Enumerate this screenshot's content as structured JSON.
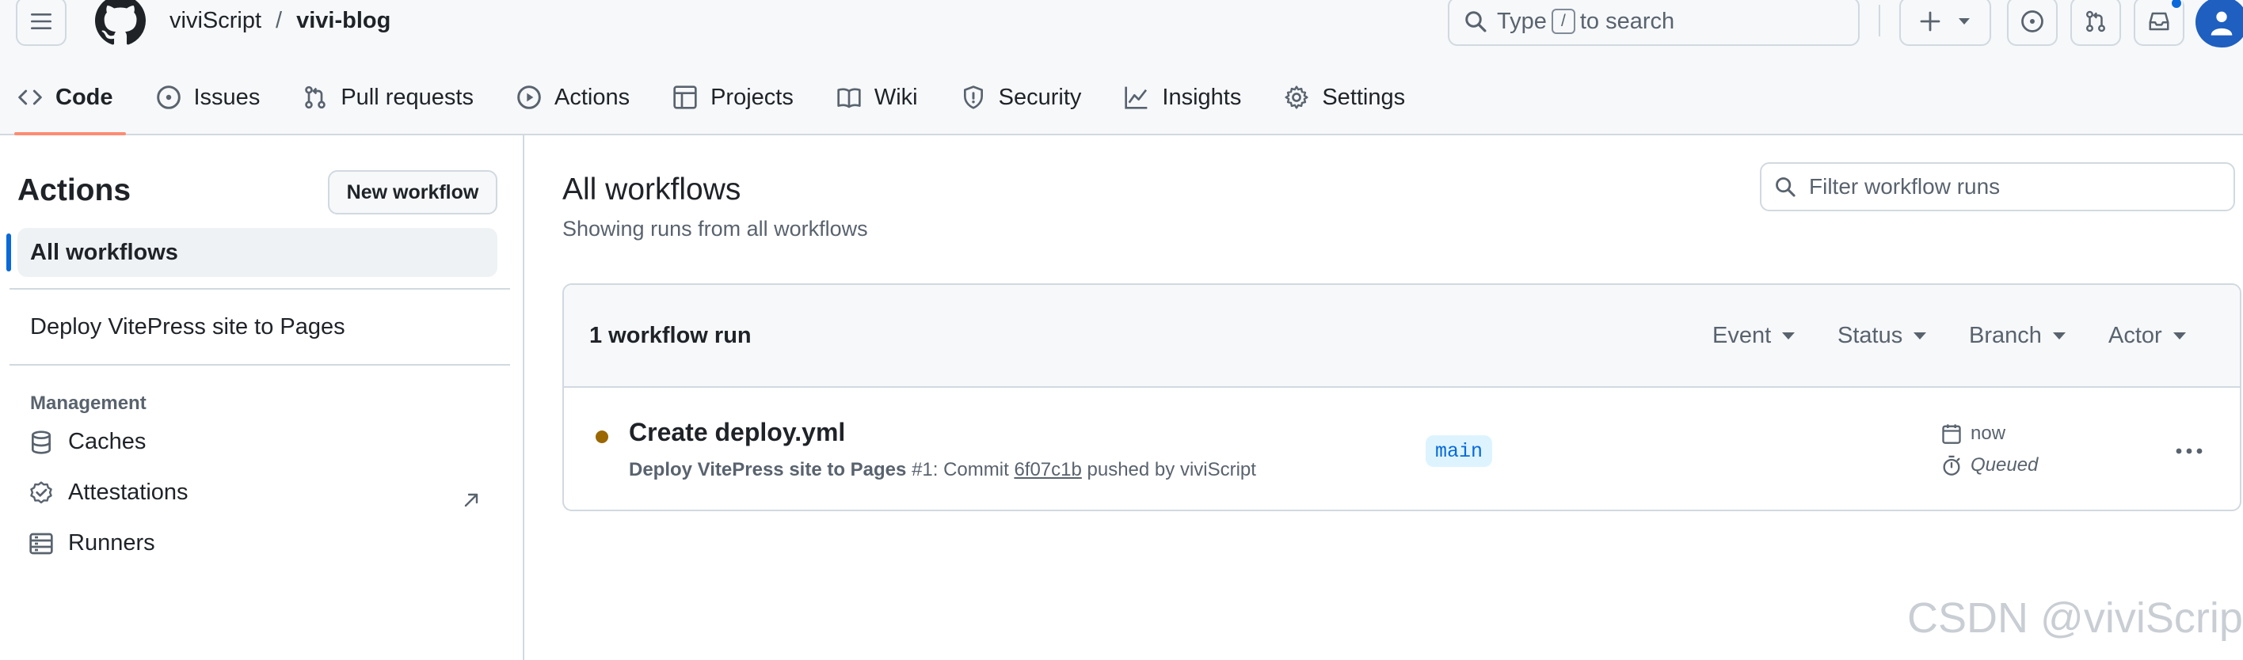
{
  "header": {
    "owner": "viviScript",
    "separator": "/",
    "repo": "vivi-blog",
    "search": {
      "prefix": "Type",
      "key": "/",
      "suffix": "to search"
    }
  },
  "tabs": [
    {
      "label": "Code",
      "icon": "code-icon",
      "selected": true
    },
    {
      "label": "Issues",
      "icon": "issue-icon"
    },
    {
      "label": "Pull requests",
      "icon": "pull-request-icon"
    },
    {
      "label": "Actions",
      "icon": "play-icon"
    },
    {
      "label": "Projects",
      "icon": "table-icon"
    },
    {
      "label": "Wiki",
      "icon": "book-icon"
    },
    {
      "label": "Security",
      "icon": "shield-icon"
    },
    {
      "label": "Insights",
      "icon": "graph-icon"
    },
    {
      "label": "Settings",
      "icon": "gear-icon"
    }
  ],
  "sidebar": {
    "title": "Actions",
    "new_workflow": "New workflow",
    "all_workflows": "All workflows",
    "workflows": [
      "Deploy VitePress site to Pages"
    ],
    "management": {
      "heading": "Management",
      "items": [
        {
          "label": "Caches",
          "icon": "database-icon"
        },
        {
          "label": "Attestations",
          "icon": "verified-icon"
        },
        {
          "label": "Runners",
          "icon": "server-icon"
        }
      ]
    }
  },
  "main": {
    "title": "All workflows",
    "subtitle": "Showing runs from all workflows",
    "filter_placeholder": "Filter workflow runs",
    "run_count": "1 workflow run",
    "filters": [
      "Event",
      "Status",
      "Branch",
      "Actor"
    ],
    "run": {
      "title": "Create deploy.yml",
      "workflow": "Deploy VitePress site to Pages",
      "run_number": "#1",
      "commit_prefix": ": Commit",
      "sha": "6f07c1b",
      "pushed_by": "pushed by viviScript",
      "branch": "main",
      "time": "now",
      "status": "Queued"
    }
  },
  "watermark": "CSDN @viviScript",
  "colors": {
    "accent": "#0969da",
    "tab_underline": "#fd8c73",
    "queued_dot": "#9a6700",
    "border": "#d1d9e0",
    "muted_text": "#59636e"
  }
}
